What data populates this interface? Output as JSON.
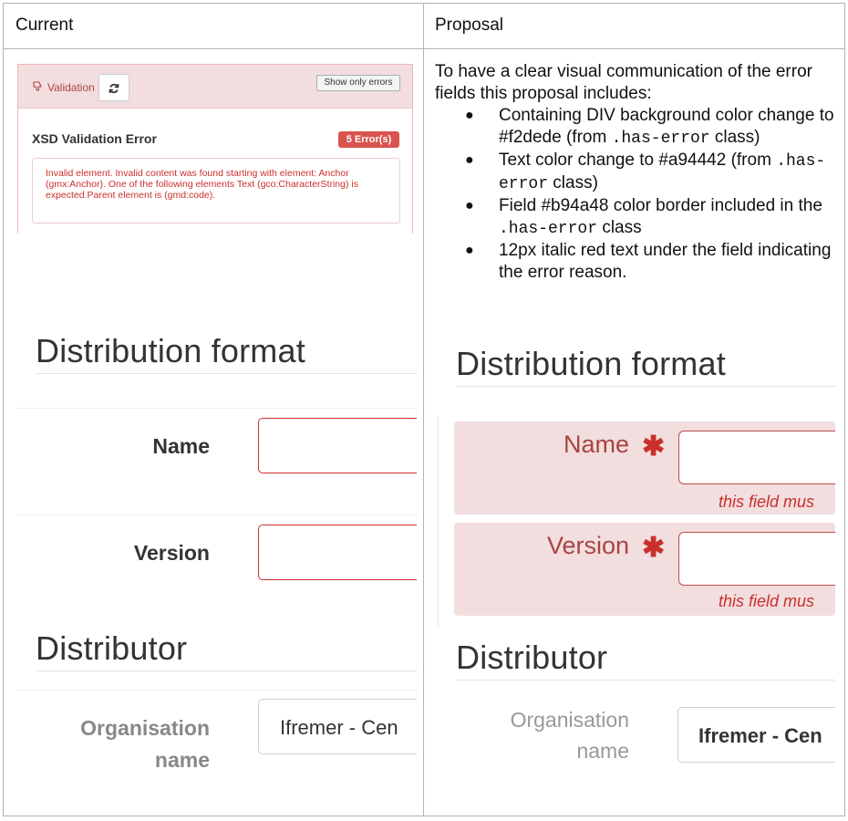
{
  "columns": {
    "current": "Current",
    "proposal": "Proposal"
  },
  "current": {
    "validation": {
      "label": "Validation",
      "refresh_icon": "refresh-icon",
      "show_errors": "Show only errors",
      "title": "XSD Validation Error",
      "badge": "5 Error(s)",
      "message": "Invalid element. Invalid content was found starting with element: Anchor (gmx:Anchor). One of the following elements Text (gco:CharacterString) is expected.Parent element is (gmd:code)."
    },
    "section1": "Distribution format",
    "name_label": "Name",
    "version_label": "Version",
    "section2": "Distributor",
    "org_label_1": "Organisation",
    "org_label_2": "name",
    "org_value": "Ifremer - Cen"
  },
  "proposal": {
    "intro": "To have a clear visual communication of the error fields this proposal includes:",
    "bullets": [
      {
        "pre": "Containing DIV background color change to #f2dede (from",
        "code": ".has-error",
        "post": "class)"
      },
      {
        "pre": "Text color change to #a94442 (from",
        "code": ".has-error",
        "post": "class)"
      },
      {
        "pre": "Field #b94a48 color border included in the",
        "code": ".has-error",
        "post": "class"
      },
      {
        "pre": "12px italic red text under the field indicating the error reason.",
        "code": "",
        "post": ""
      }
    ],
    "section1": "Distribution format",
    "name_label": "Name",
    "version_label": "Version",
    "required_mark": "✱",
    "error_msg": "this field mus",
    "section2": "Distributor",
    "org_label_1": "Organisation",
    "org_label_2": "name",
    "org_value": "Ifremer - Cen"
  },
  "colors": {
    "error_bg": "#f2dede",
    "error_text": "#a94442",
    "error_border": "#b94a48"
  }
}
